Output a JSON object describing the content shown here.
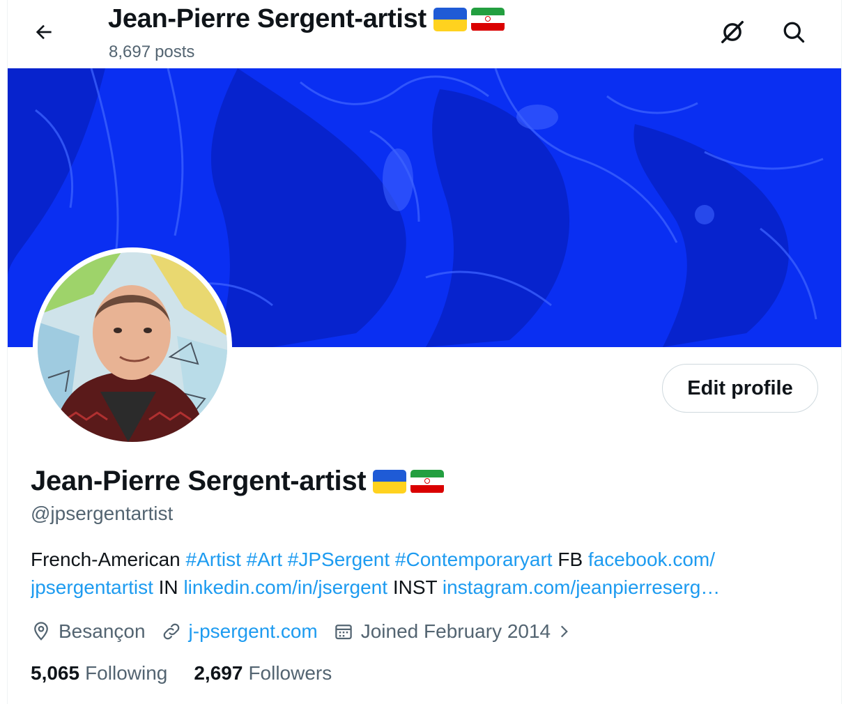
{
  "header": {
    "title": "Jean-Pierre Sergent-artist",
    "posts_count": "8,697",
    "posts_label": "posts"
  },
  "profile": {
    "name": "Jean-Pierre Sergent-artist",
    "handle": "@jpsergentartist",
    "edit_button": "Edit profile",
    "bio": {
      "t1": "French-American",
      "tag1": "#Artist",
      "tag2": "#Art",
      "tag3": "#JPSergent",
      "tag4": "#Contemporaryart",
      "t2": "FB",
      "link_fb_1": "facebook.com/",
      "link_fb_2": "jpsergentartist",
      "t3": "IN",
      "link_in": "linkedin.com/in/jsergent",
      "t4": "INST",
      "link_inst": "instagram.com/jeanpierreserg…"
    },
    "location": "Besançon",
    "website": "j-psergent.com",
    "joined": "Joined February 2014",
    "following_count": "5,065",
    "following_label": "Following",
    "followers_count": "2,697",
    "followers_label": "Followers"
  },
  "flags": [
    "ukraine-flag",
    "iran-flag"
  ],
  "colors": {
    "banner": "#0a2ff2",
    "link": "#1d9bf0",
    "secondary_text": "#536471"
  }
}
